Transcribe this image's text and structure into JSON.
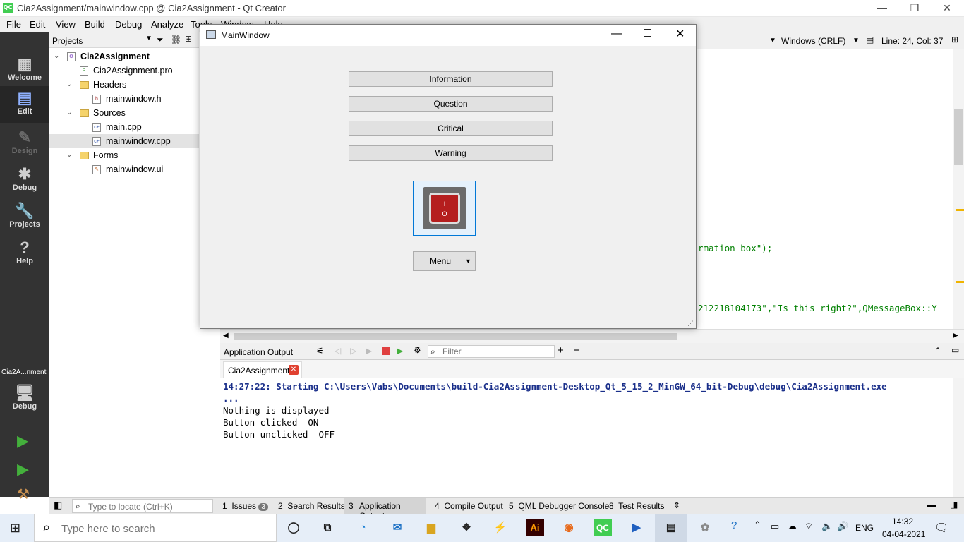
{
  "window": {
    "title": "Cia2Assignment/mainwindow.cpp @ Cia2Assignment - Qt Creator",
    "icon_text": "QC"
  },
  "menu": [
    "File",
    "Edit",
    "View",
    "Build",
    "Debug",
    "Analyze",
    "Tools",
    "Window",
    "Help"
  ],
  "modes": [
    {
      "label": "Welcome",
      "icon": "grid-icon",
      "state": "normal"
    },
    {
      "label": "Edit",
      "icon": "edit-icon",
      "state": "active"
    },
    {
      "label": "Design",
      "icon": "pencil-icon",
      "state": "disabled"
    },
    {
      "label": "Debug",
      "icon": "bug-icon",
      "state": "normal"
    },
    {
      "label": "Projects",
      "icon": "wrench-icon",
      "state": "normal"
    },
    {
      "label": "Help",
      "icon": "help-icon",
      "state": "normal"
    }
  ],
  "kit": {
    "project": "Cia2A...nment",
    "label": "Debug"
  },
  "projects_pane": {
    "title": "Projects"
  },
  "tree": [
    {
      "label": "Cia2Assignment",
      "level": 0,
      "expanded": true,
      "kind": "project",
      "bold": true
    },
    {
      "label": "Cia2Assignment.pro",
      "level": 1,
      "kind": "pro"
    },
    {
      "label": "Headers",
      "level": 1,
      "expanded": true,
      "kind": "folder"
    },
    {
      "label": "mainwindow.h",
      "level": 2,
      "kind": "h"
    },
    {
      "label": "Sources",
      "level": 1,
      "expanded": true,
      "kind": "folder"
    },
    {
      "label": "main.cpp",
      "level": 2,
      "kind": "cpp"
    },
    {
      "label": "mainwindow.cpp",
      "level": 2,
      "kind": "cpp",
      "selected": true
    },
    {
      "label": "Forms",
      "level": 1,
      "expanded": true,
      "kind": "folder"
    },
    {
      "label": "mainwindow.ui",
      "level": 2,
      "kind": "ui"
    }
  ],
  "editor": {
    "line_ending": "Windows (CRLF)",
    "position": "Line: 24, Col: 37",
    "code_fragments": [
      "rmation box\");",
      "212218104173\",\"Is this right?\",QMessageBox::Y"
    ]
  },
  "app_window": {
    "title": "MainWindow",
    "buttons": [
      "Information",
      "Question",
      "Critical",
      "Warning"
    ],
    "toggle": {
      "on": "I",
      "off": "O"
    },
    "menu_button": "Menu"
  },
  "output": {
    "title": "Application Output",
    "filter_placeholder": "Filter",
    "tab": "Cia2Assignment",
    "lines": [
      "14:27:22: Starting C:\\Users\\Vabs\\Documents\\build-Cia2Assignment-Desktop_Qt_5_15_2_MinGW_64_bit-Debug\\debug\\Cia2Assignment.exe",
      "...",
      "Nothing is displayed",
      "Button clicked--ON--",
      "Button unclicked--OFF--"
    ]
  },
  "statusbar": {
    "locator_placeholder": "Type to locate (Ctrl+K)",
    "tabs": [
      {
        "num": "1",
        "label": "Issues",
        "badge": "3"
      },
      {
        "num": "2",
        "label": "Search Results"
      },
      {
        "num": "3",
        "label": "Application Output",
        "active": true
      },
      {
        "num": "4",
        "label": "Compile Output"
      },
      {
        "num": "5",
        "label": "QML Debugger Console"
      },
      {
        "num": "8",
        "label": "Test Results"
      }
    ]
  },
  "taskbar": {
    "search_placeholder": "Type here to search",
    "lang": "ENG",
    "time": "14:32",
    "date": "04-04-2021"
  },
  "colors": {
    "sidebar": "#333333",
    "accent": "#0078d7",
    "output_blue": "#1a2f8a",
    "string_green": "#008000",
    "keyword_purple": "#800080",
    "qt_green": "#41cd52"
  }
}
